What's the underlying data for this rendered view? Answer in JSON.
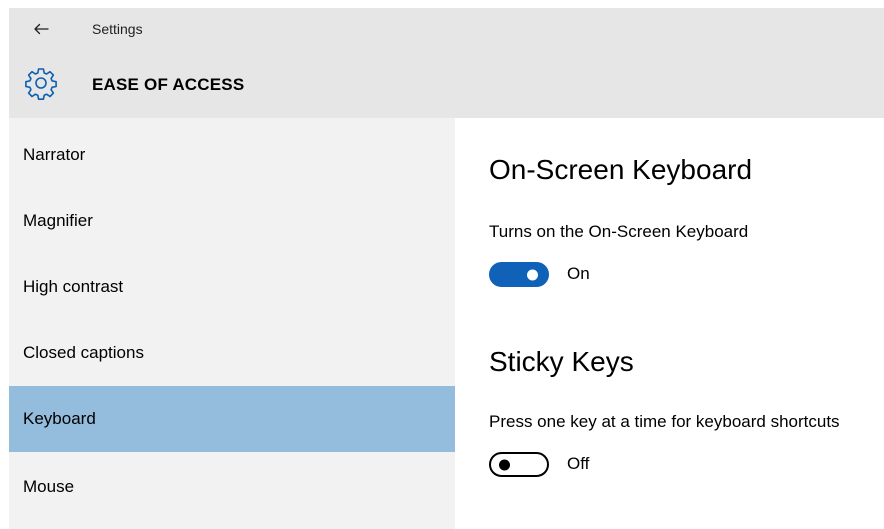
{
  "window": {
    "title": "Settings",
    "back_icon": "back-arrow-icon"
  },
  "header": {
    "icon": "gear-icon",
    "title": "EASE OF ACCESS"
  },
  "sidebar": {
    "items": [
      {
        "label": "Narrator",
        "selected": false
      },
      {
        "label": "Magnifier",
        "selected": false
      },
      {
        "label": "High contrast",
        "selected": false
      },
      {
        "label": "Closed captions",
        "selected": false
      },
      {
        "label": "Keyboard",
        "selected": true
      },
      {
        "label": "Mouse",
        "selected": false
      }
    ]
  },
  "content": {
    "on_screen_keyboard": {
      "title": "On-Screen Keyboard",
      "description": "Turns on the On-Screen Keyboard",
      "toggle_state": "On",
      "enabled": true
    },
    "sticky_keys": {
      "title": "Sticky Keys",
      "description": "Press one key at a time for keyboard shortcuts",
      "toggle_state": "Off",
      "enabled": false
    }
  },
  "colors": {
    "header_bg": "#e6e6e6",
    "sidebar_bg": "#f2f2f2",
    "selected_bg": "#94bcdc",
    "toggle_on": "#0f62b8",
    "accent_icon": "#0a5fb4"
  }
}
